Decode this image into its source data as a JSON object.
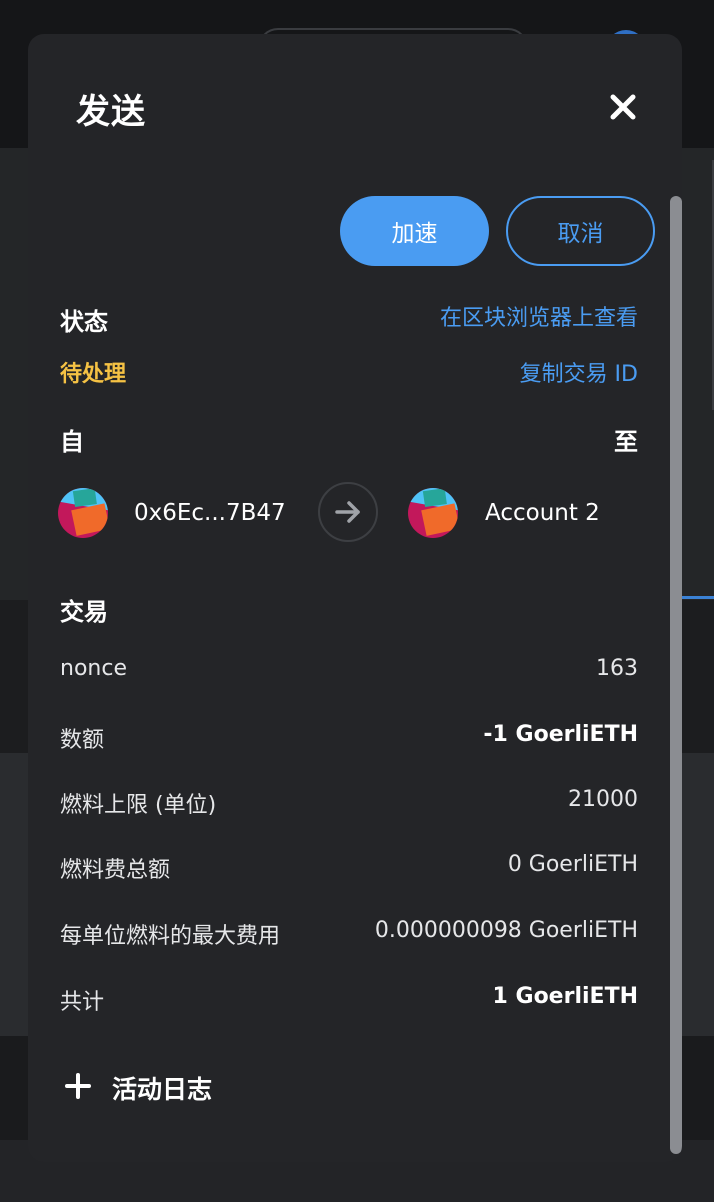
{
  "modal": {
    "title": "发送",
    "buttons": {
      "speed_up": "加速",
      "cancel": "取消"
    },
    "status": {
      "label": "状态",
      "value": "待处理",
      "view_on_explorer": "在区块浏览器上查看",
      "copy_tx_id": "复制交易 ID"
    },
    "from_label": "自",
    "to_label": "至",
    "from_address": "0x6Ec...7B47",
    "to_account": "Account 2",
    "transaction": {
      "heading": "交易",
      "rows": [
        {
          "label": "nonce",
          "value": "163"
        },
        {
          "label": "数额",
          "value": "-1 GoerliETH"
        },
        {
          "label": "燃料上限 (单位)",
          "value": "21000"
        },
        {
          "label": "燃料费总额",
          "value": "0 GoerliETH"
        },
        {
          "label": "每单位燃料的最大费用",
          "value": "0.000000098 GoerliETH"
        },
        {
          "label": "共计",
          "value": "1 GoerliETH"
        }
      ]
    },
    "activity_log": "活动日志"
  },
  "colors": {
    "accent": "#4a9cf2",
    "pending": "#f5c244",
    "modal_bg": "#242528"
  },
  "icons": [
    "close-icon",
    "arrow-right-icon",
    "plus-icon",
    "account-avatar-icon"
  ]
}
